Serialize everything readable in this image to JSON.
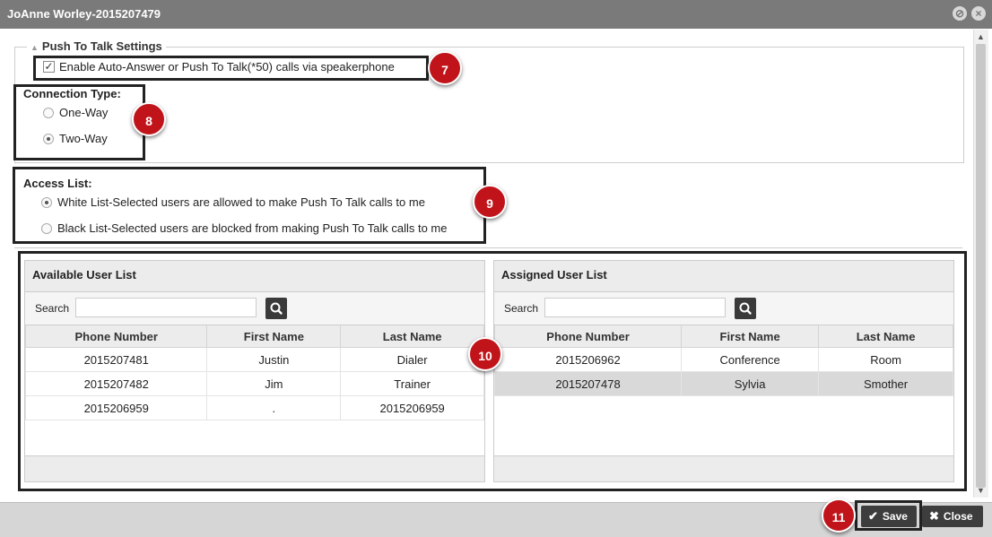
{
  "window": {
    "title": "JoAnne Worley-2015207479"
  },
  "settings": {
    "legend": "Push To Talk Settings",
    "auto_answer_label": "Enable Auto-Answer or Push To Talk(*50) calls via speakerphone",
    "connection_type_label": "Connection Type:",
    "one_way_label": "One-Way",
    "two_way_label": "Two-Way",
    "access_list_label": "Access List:",
    "white_list_label": "White List-Selected users are allowed to make Push To Talk calls to me",
    "black_list_label": "Black List-Selected users are blocked from making Push To Talk calls to me"
  },
  "badges": {
    "b7": "7",
    "b8": "8",
    "b9": "9",
    "b10": "10",
    "b11": "11"
  },
  "available": {
    "title": "Available User List",
    "search_label": "Search",
    "columns": [
      "Phone Number",
      "First Name",
      "Last Name"
    ],
    "rows": [
      [
        "2015207481",
        "Justin",
        "Dialer"
      ],
      [
        "2015207482",
        "Jim",
        "Trainer"
      ],
      [
        "2015206959",
        ".",
        "2015206959"
      ]
    ]
  },
  "assigned": {
    "title": "Assigned User List",
    "search_label": "Search",
    "columns": [
      "Phone Number",
      "First Name",
      "Last Name"
    ],
    "rows": [
      [
        "2015206962",
        "Conference",
        "Room"
      ],
      [
        "2015207478",
        "Sylvia",
        "Smother"
      ]
    ]
  },
  "footer": {
    "save_label": "Save",
    "close_label": "Close"
  }
}
